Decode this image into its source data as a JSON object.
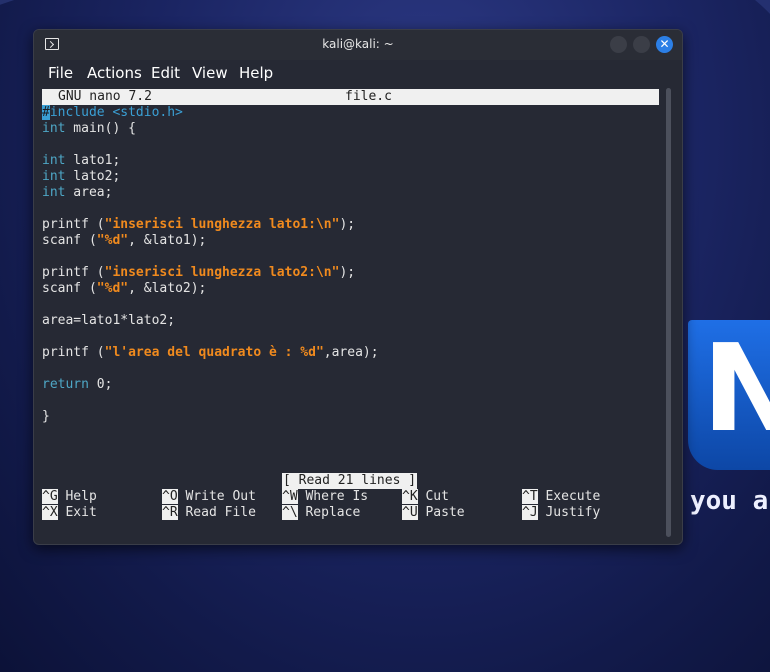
{
  "wallpaper": {
    "logo_letter": "N",
    "quote_tail": "you are"
  },
  "window": {
    "title": "kali@kali: ~",
    "close_symbol": "✕",
    "menu": [
      "File",
      "Actions",
      "Edit",
      "View",
      "Help"
    ]
  },
  "nano": {
    "version": "GNU nano 7.2",
    "filename": "file.c",
    "status": "[ Read 21 lines ]",
    "code": {
      "l1_cursor": "#",
      "l1_rest": "include <stdio.h>",
      "l2_kw": "int",
      "l2_rest": " main() {",
      "l4_kw": "int",
      "l4_rest": " lato1;",
      "l5_kw": "int",
      "l5_rest": " lato2;",
      "l6_kw": "int",
      "l6_rest": " area;",
      "l8_a": "printf (",
      "l8_str": "\"inserisci lunghezza lato1:\\n\"",
      "l8_b": ");",
      "l9_a": "scanf (",
      "l9_str": "\"%d\"",
      "l9_b": ", &lato1);",
      "l11_a": "printf (",
      "l11_str": "\"inserisci lunghezza lato2:\\n\"",
      "l11_b": ");",
      "l12_a": "scanf (",
      "l12_str": "\"%d\"",
      "l12_b": ", &lato2);",
      "l14": "area=lato1*lato2;",
      "l16_a": "printf (",
      "l16_str": "\"l'area del quadrato è : %d\"",
      "l16_b": ",area);",
      "l18_kw": "return",
      "l18_rest": " 0;",
      "l20": "}"
    },
    "shortcuts": [
      {
        "key": "^G",
        "label": "Help"
      },
      {
        "key": "^O",
        "label": "Write Out"
      },
      {
        "key": "^W",
        "label": "Where Is"
      },
      {
        "key": "^K",
        "label": "Cut"
      },
      {
        "key": "^T",
        "label": "Execute"
      },
      {
        "key": "^X",
        "label": "Exit"
      },
      {
        "key": "^R",
        "label": "Read File"
      },
      {
        "key": "^\\",
        "label": "Replace"
      },
      {
        "key": "^U",
        "label": "Paste"
      },
      {
        "key": "^J",
        "label": "Justify"
      }
    ]
  }
}
